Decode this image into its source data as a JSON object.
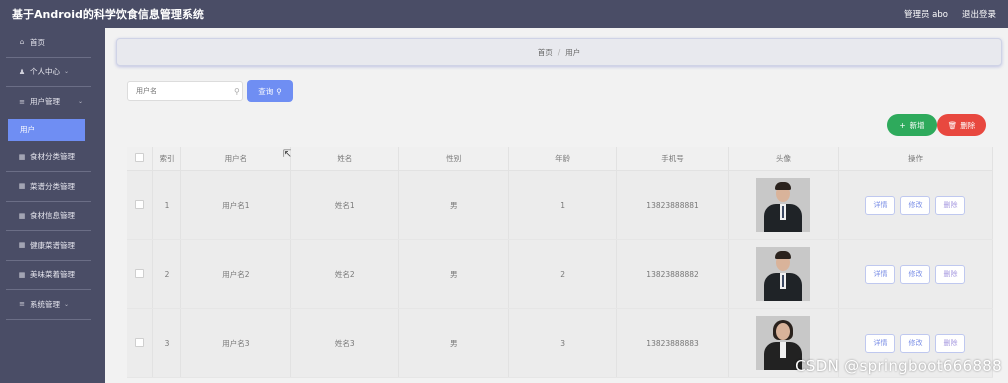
{
  "header": {
    "title": "基于Android的科学饮食信息管理系统",
    "admin": "管理员 abo",
    "logout": "退出登录"
  },
  "sidebar": {
    "home": {
      "label": "首页",
      "icon": "home-icon"
    },
    "items": [
      {
        "label": "个人中心",
        "icon": "user-icon"
      },
      {
        "label": "用户管理",
        "icon": "list-icon"
      },
      {
        "label": "食材分类管理",
        "icon": "grid-icon"
      },
      {
        "label": "菜谱分类管理",
        "icon": "grid-icon"
      },
      {
        "label": "食材信息管理",
        "icon": "grid-icon"
      },
      {
        "label": "健康菜谱管理",
        "icon": "grid-icon"
      },
      {
        "label": "美味菜着管理",
        "icon": "grid-icon"
      },
      {
        "label": "系统管理",
        "icon": "list-icon"
      }
    ],
    "active_sub": "用户"
  },
  "breadcrumb": {
    "home": "首页",
    "current": "用户"
  },
  "search": {
    "placeholder": "用户名",
    "button": "查询"
  },
  "actions": {
    "add": "新增",
    "delete": "删除"
  },
  "table": {
    "headers": [
      "",
      "索引",
      "用户名",
      "姓名",
      "性别",
      "年龄",
      "手机号",
      "头像",
      "操作"
    ],
    "rows": [
      {
        "index": "1",
        "username": "用户名1",
        "name": "姓名1",
        "gender": "男",
        "age": "1",
        "phone": "13823888881",
        "avatar": "male"
      },
      {
        "index": "2",
        "username": "用户名2",
        "name": "姓名2",
        "gender": "男",
        "age": "2",
        "phone": "13823888882",
        "avatar": "male"
      },
      {
        "index": "3",
        "username": "用户名3",
        "name": "姓名3",
        "gender": "男",
        "age": "3",
        "phone": "13823888883",
        "avatar": "female"
      }
    ],
    "row_actions": {
      "detail": "详情",
      "edit": "修改",
      "delete": "删除"
    }
  },
  "watermark": "CSDN @springboot666888"
}
